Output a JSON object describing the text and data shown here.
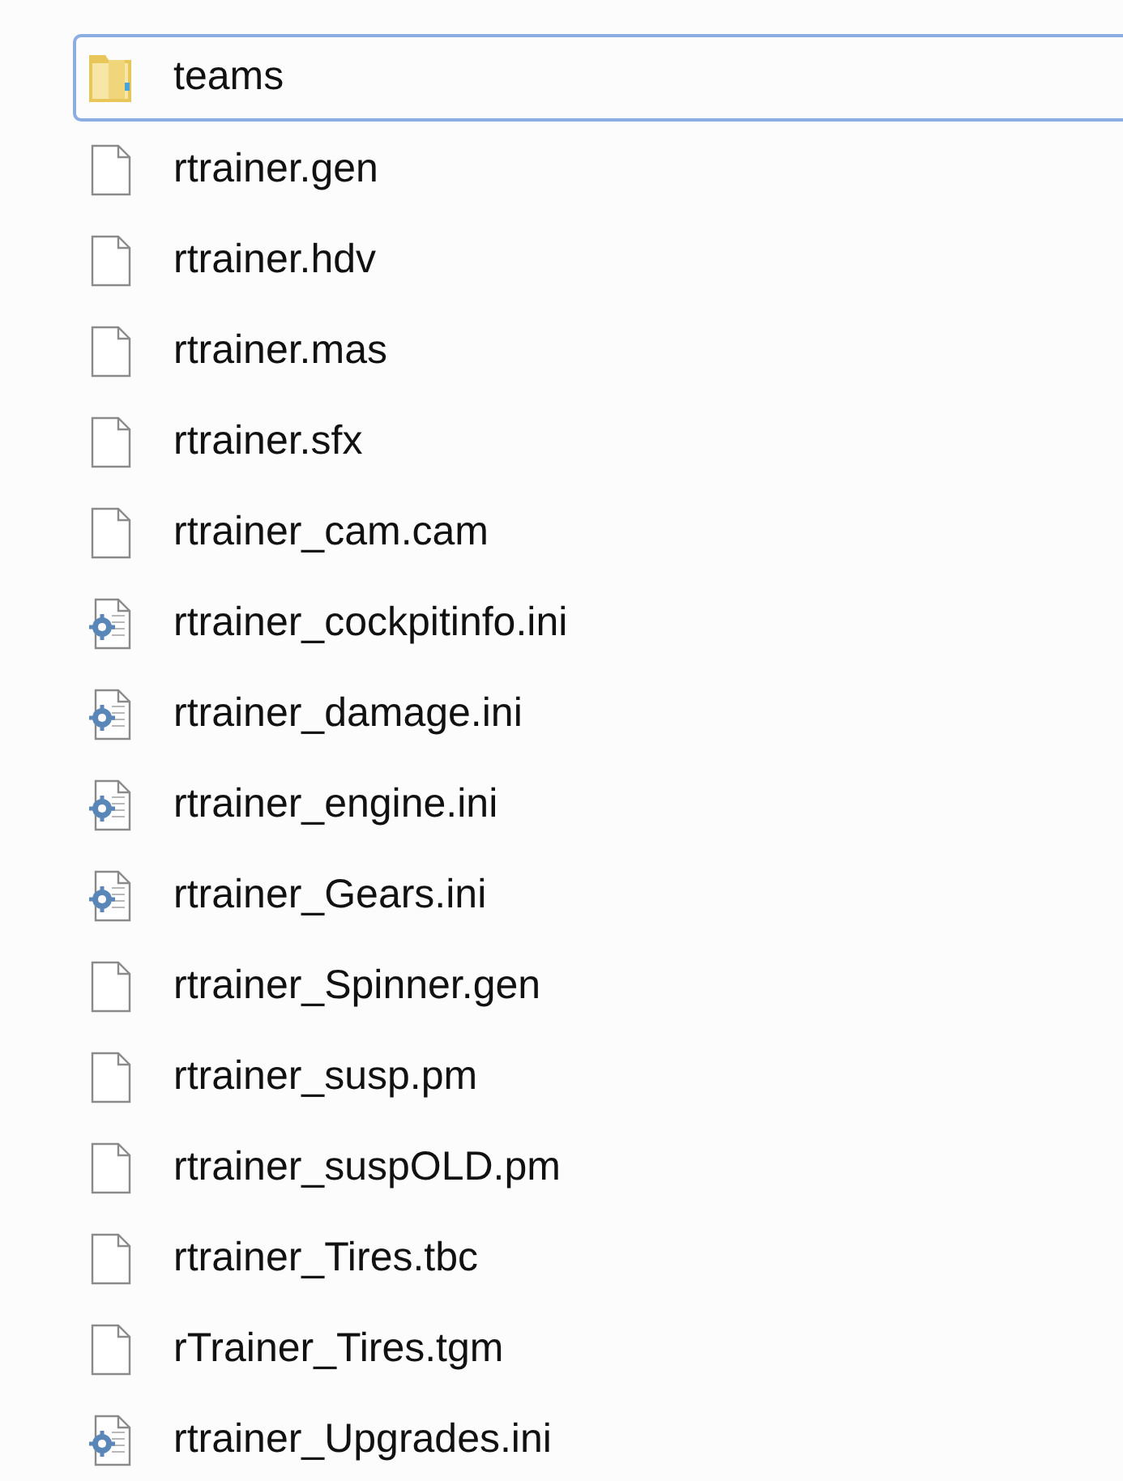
{
  "files": [
    {
      "name": "teams",
      "kind": "folder",
      "focused": true
    },
    {
      "name": "rtrainer.gen",
      "kind": "file",
      "focused": false
    },
    {
      "name": "rtrainer.hdv",
      "kind": "file",
      "focused": false
    },
    {
      "name": "rtrainer.mas",
      "kind": "file",
      "focused": false
    },
    {
      "name": "rtrainer.sfx",
      "kind": "file",
      "focused": false
    },
    {
      "name": "rtrainer_cam.cam",
      "kind": "file",
      "focused": false
    },
    {
      "name": "rtrainer_cockpitinfo.ini",
      "kind": "config",
      "focused": false
    },
    {
      "name": "rtrainer_damage.ini",
      "kind": "config",
      "focused": false
    },
    {
      "name": "rtrainer_engine.ini",
      "kind": "config",
      "focused": false
    },
    {
      "name": "rtrainer_Gears.ini",
      "kind": "config",
      "focused": false
    },
    {
      "name": "rtrainer_Spinner.gen",
      "kind": "file",
      "focused": false
    },
    {
      "name": "rtrainer_susp.pm",
      "kind": "file",
      "focused": false
    },
    {
      "name": "rtrainer_suspOLD.pm",
      "kind": "file",
      "focused": false
    },
    {
      "name": "rtrainer_Tires.tbc",
      "kind": "file",
      "focused": false
    },
    {
      "name": "rTrainer_Tires.tgm",
      "kind": "file",
      "focused": false
    },
    {
      "name": "rtrainer_Upgrades.ini",
      "kind": "config",
      "focused": false
    }
  ]
}
